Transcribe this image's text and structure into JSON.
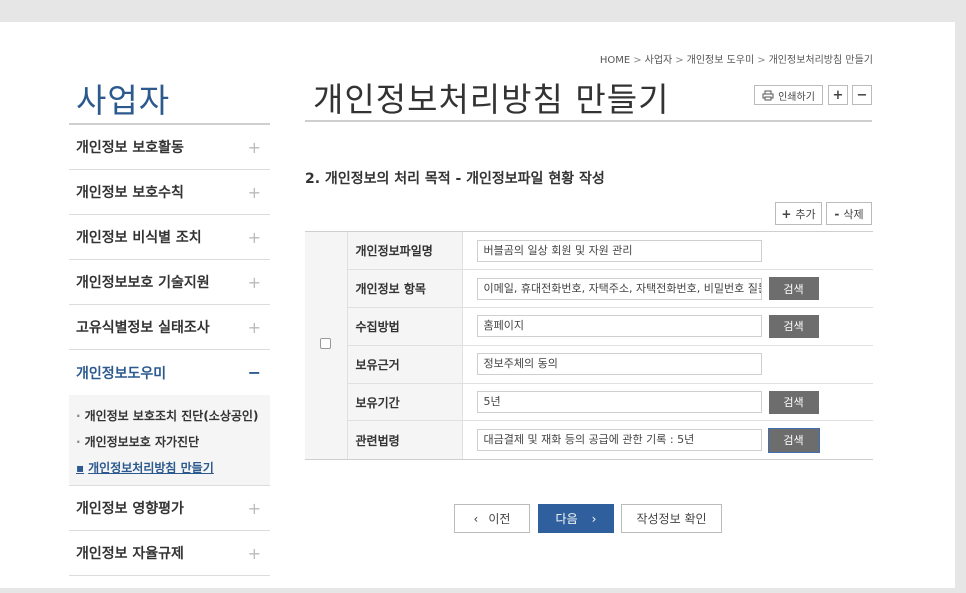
{
  "sidebar": {
    "title": "사업자",
    "items": [
      {
        "label": "개인정보 보호활동",
        "toggle": "+"
      },
      {
        "label": "개인정보 보호수칙",
        "toggle": "+"
      },
      {
        "label": "개인정보 비식별 조치",
        "toggle": "+"
      },
      {
        "label": "개인정보보호 기술지원",
        "toggle": "+"
      },
      {
        "label": "고유식별정보 실태조사",
        "toggle": "+"
      },
      {
        "label": "개인정보도우미",
        "toggle": "−"
      },
      {
        "label": "개인정보 영향평가",
        "toggle": "+"
      },
      {
        "label": "개인정보 자율규제",
        "toggle": "+"
      }
    ],
    "sub_items": [
      {
        "dot": "·",
        "label": "개인정보 보호조치 진단(소상공인)"
      },
      {
        "dot": "·",
        "label": "개인정보보호 자가진단"
      },
      {
        "dot": "▪",
        "label": "개인정보처리방침 만들기"
      }
    ]
  },
  "breadcrumb": {
    "items": [
      "HOME",
      "사업자",
      "개인정보 도우미",
      "개인정보처리방침 만들기"
    ],
    "separator": ">"
  },
  "header": {
    "title": "개인정보처리방침 만들기",
    "print_label": "인쇄하기",
    "zoom_in": "+",
    "zoom_out": "−"
  },
  "section": {
    "title": "2. 개인정보의 처리 목적 - 개인정보파일 현황 작성",
    "add_label": "추가",
    "add_symbol": "+",
    "delete_label": "삭제",
    "delete_symbol": "-"
  },
  "form": {
    "search_label": "검색",
    "rows": [
      {
        "label": "개인정보파일명",
        "value": "버블곰의 일상 회원 및 자원 관리"
      },
      {
        "label": "개인정보 항목",
        "value": "이메일, 휴대전화번호, 자택주소, 자택전화번호, 비밀번호 질문"
      },
      {
        "label": "수집방법",
        "value": "홈페이지"
      },
      {
        "label": "보유근거",
        "value": "정보주체의 동의"
      },
      {
        "label": "보유기간",
        "value": "5년"
      },
      {
        "label": "관련법령",
        "value": "대금결제 및 재화 등의 공급에 관한 기록 : 5년"
      }
    ]
  },
  "pager": {
    "prev_symbol": "‹",
    "prev_label": "이전",
    "next_label": "다음",
    "next_symbol": "›",
    "confirm_label": "작성정보 확인"
  },
  "colors": {
    "brand_blue": "#2c5a8f",
    "next_button": "#2f5f9c",
    "search_button": "#6d6d6d"
  }
}
